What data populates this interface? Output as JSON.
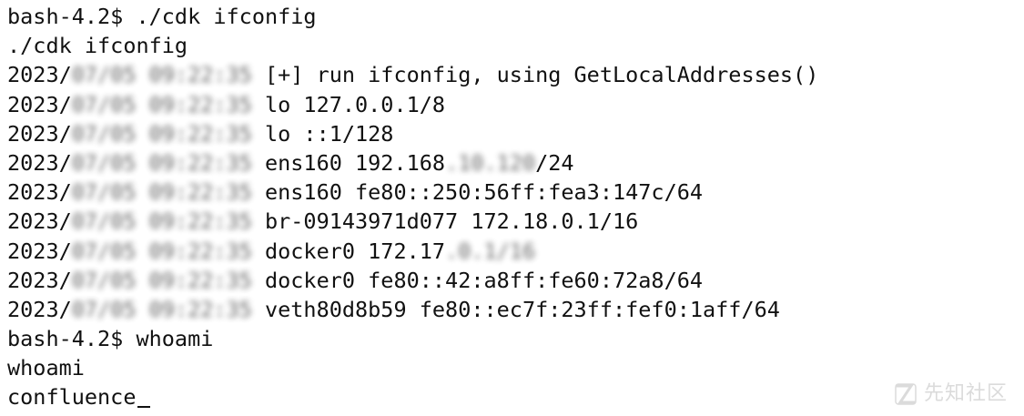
{
  "terminal": {
    "lines": [
      {
        "plain": "bash-4.2$ ./cdk ifconfig"
      },
      {
        "plain": "./cdk ifconfig"
      },
      {
        "prefix": "2023/",
        "blur": "07/05 09:22:35",
        "rest": " [+] run ifconfig, using GetLocalAddresses()"
      },
      {
        "prefix": "2023/",
        "blur": "07/05 09:22:35",
        "rest": " lo 127.0.0.1/8"
      },
      {
        "prefix": "2023/",
        "blur": "07/05 09:22:35",
        "rest": " lo ::1/128"
      },
      {
        "prefix": "2023/",
        "blur": "07/05 09:22:35",
        "rest": " ens160 192.168",
        "blur2": ".10.120",
        "rest2": "/24"
      },
      {
        "prefix": "2023/",
        "blur": "07/05 09:22:35",
        "rest": " ens160 fe80::250:56ff:fea3:147c/64"
      },
      {
        "prefix": "2023/",
        "blur": "07/05 09:22:35",
        "rest": " br-09143971d077 172.18.0.1/16"
      },
      {
        "prefix": "2023/",
        "blur": "07/05 09:22:35",
        "rest": " docker0 172.17",
        "blur2": ".0.1/16",
        "rest2": ""
      },
      {
        "prefix": "2023/",
        "blur": "07/05 09:22:35",
        "rest": " docker0 fe80::42:a8ff:fe60:72a8/64"
      },
      {
        "prefix": "2023/",
        "blur": "07/05 09:22:35",
        "rest": " veth80d8b59 fe80::ec7f:23ff:fef0:1aff/64"
      },
      {
        "plain": "bash-4.2$ whoami"
      },
      {
        "plain": "whoami"
      },
      {
        "plain": "confluence",
        "cursor": true
      }
    ]
  },
  "watermark": {
    "text": "先知社区",
    "icon": "xianzhi-logo-icon",
    "color": "#9a9a9a"
  }
}
